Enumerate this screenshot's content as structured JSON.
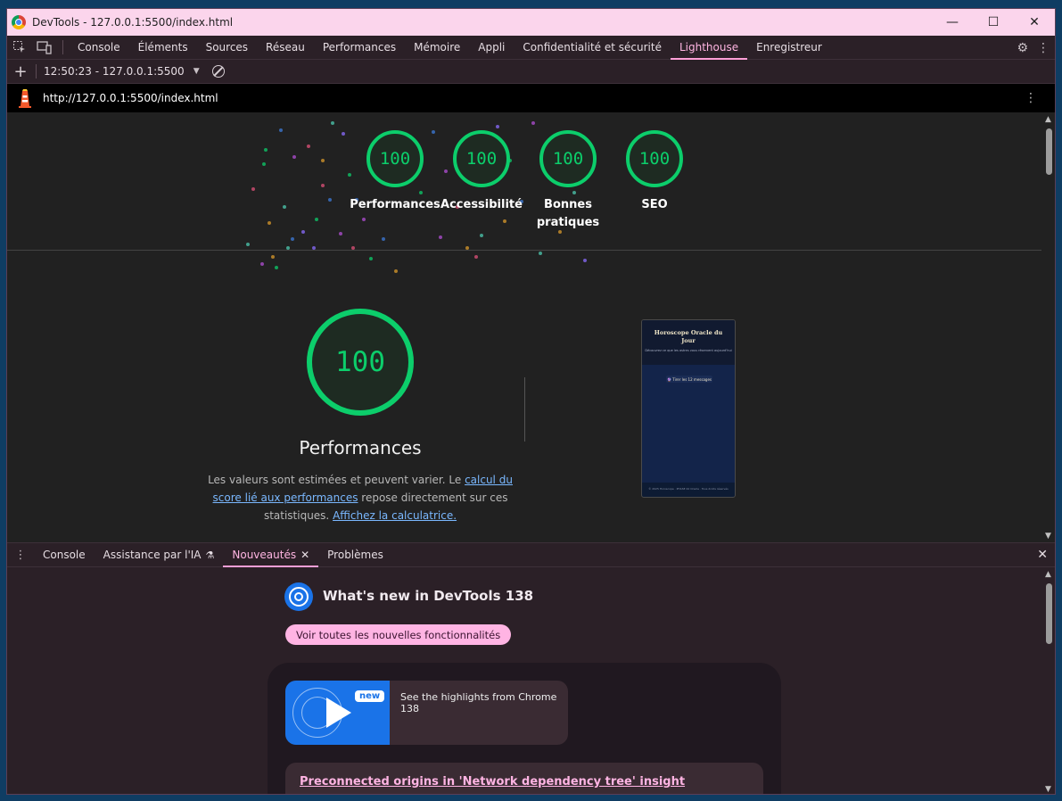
{
  "window": {
    "title": "DevTools - 127.0.0.1:5500/index.html",
    "controls": {
      "minimize": "—",
      "maximize": "☐",
      "close": "✕"
    }
  },
  "main_tabs": [
    {
      "label": "Console",
      "active": false
    },
    {
      "label": "Éléments",
      "active": false
    },
    {
      "label": "Sources",
      "active": false
    },
    {
      "label": "Réseau",
      "active": false
    },
    {
      "label": "Performances",
      "active": false
    },
    {
      "label": "Mémoire",
      "active": false
    },
    {
      "label": "Appli",
      "active": false
    },
    {
      "label": "Confidentialité et sécurité",
      "active": false
    },
    {
      "label": "Lighthouse",
      "active": true
    },
    {
      "label": "Enregistreur",
      "active": false
    }
  ],
  "lighthouse_toolbar": {
    "report_selector": "12:50:23 - 127.0.0.1:5500"
  },
  "urlbar": {
    "url": "http://127.0.0.1:5500/index.html"
  },
  "scores": [
    {
      "label": "Performances",
      "value": "100"
    },
    {
      "label": "Accessibilité",
      "value": "100"
    },
    {
      "label": "Bonnes pratiques",
      "value": "100"
    },
    {
      "label": "SEO",
      "value": "100"
    }
  ],
  "performance_section": {
    "score": "100",
    "title": "Performances",
    "desc_part1": "Les valeurs sont estimées et peuvent varier. Le ",
    "desc_link1": "calcul du score lié aux performances",
    "desc_part2": " repose directement sur ces statistiques. ",
    "desc_link2": "Affichez la calculatrice."
  },
  "screenshot_preview": {
    "title": "Horoscope Oracle du Jour",
    "subtitle": "Découvrez ce que les astres vous réservent aujourd'hui",
    "button": "🔮 Tirer les 12 messages",
    "footer": "© 2025 Horoscope · PHASE 42 Oracle · Tous droits réservés"
  },
  "drawer_tabs": [
    {
      "label": "Console",
      "active": false
    },
    {
      "label": "Assistance par l'IA",
      "active": false,
      "icon": "flask-icon"
    },
    {
      "label": "Nouveautés",
      "active": true,
      "closable": true
    },
    {
      "label": "Problèmes",
      "active": false
    }
  ],
  "whats_new": {
    "title": "What's new in DevTools 138",
    "see_all_button": "Voir toutes les nouvelles fonctionnalités",
    "video_badge": "new",
    "video_text": "See the highlights from Chrome 138",
    "feature_link": "Preconnected origins in 'Network dependency tree' insight"
  },
  "colors": {
    "score_green": "#0cce6b",
    "accent_pink": "#ffb4e3",
    "titlebar": "#fbd5ec",
    "link_blue": "#7ab8ff"
  }
}
